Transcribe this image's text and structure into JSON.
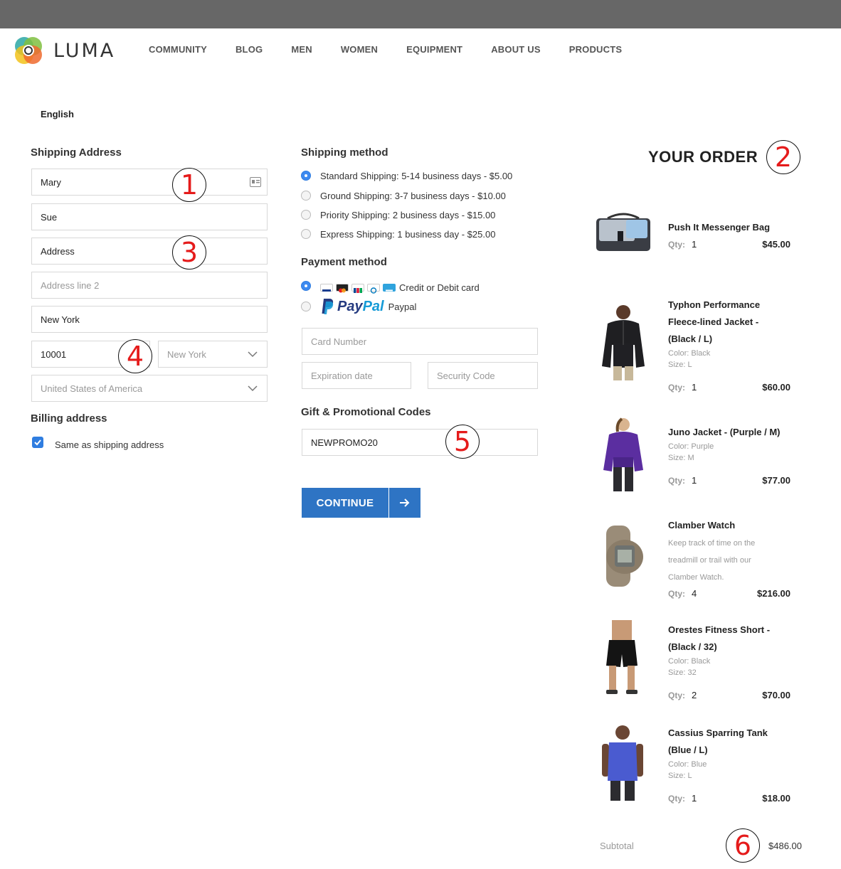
{
  "header": {
    "brand": "LUMA",
    "nav": [
      "COMMUNITY",
      "BLOG",
      "MEN",
      "WOMEN",
      "EQUIPMENT",
      "ABOUT US",
      "PRODUCTS"
    ]
  },
  "language": "English",
  "shipping_address": {
    "title": "Shipping Address",
    "first_name": "Mary",
    "last_name": "Sue",
    "address": "Address",
    "address2_placeholder": "Address line 2",
    "city": "New York",
    "zip": "10001",
    "state_placeholder": "New York",
    "country_placeholder": "United States of America"
  },
  "billing": {
    "title": "Billing address",
    "same_as_shipping_label": "Same as shipping address",
    "same_as_shipping_checked": true
  },
  "shipping_method": {
    "title": "Shipping method",
    "options": [
      "Standard Shipping: 5-14 business days - $5.00",
      "Ground Shipping: 3-7 business days - $10.00",
      "Priority Shipping: 2 business days - $15.00",
      "Express Shipping: 1 business day - $25.00"
    ],
    "selected_index": 0
  },
  "payment_method": {
    "title": "Payment method",
    "card_label": "Credit or Debit card",
    "paypal_logo_pay": "Pay",
    "paypal_logo_pal": "Pal",
    "paypal_label": "Paypal",
    "card_number_placeholder": "Card Number",
    "expiration_placeholder": "Expiration date",
    "security_placeholder": "Security Code"
  },
  "promo": {
    "title": "Gift & Promotional Codes",
    "code": "NEWPROMO20"
  },
  "continue_label": "CONTINUE",
  "order": {
    "title": "YOUR ORDER",
    "qty_label": "Qty:",
    "items": [
      {
        "name": "Push It Messenger Bag",
        "qty": "1",
        "price": "$45.00"
      },
      {
        "name_lines": [
          "Typhon Performance",
          "Fleece-lined Jacket -",
          "(Black / L)"
        ],
        "color": "Color: Black",
        "size": "Size: L",
        "qty": "1",
        "price": "$60.00"
      },
      {
        "name": "Juno Jacket - (Purple / M)",
        "color": "Color: Purple",
        "size": "Size: M",
        "qty": "1",
        "price": "$77.00"
      },
      {
        "name": "Clamber Watch",
        "desc_lines": [
          "Keep track of time on the",
          "treadmill or trail with our",
          "Clamber Watch."
        ],
        "qty": "4",
        "price": "$216.00"
      },
      {
        "name_lines": [
          "Orestes Fitness Short -",
          "(Black / 32)"
        ],
        "color": "Color: Black",
        "size": "Size: 32",
        "qty": "2",
        "price": "$70.00"
      },
      {
        "name_lines": [
          "Cassius Sparring Tank",
          "(Blue / L)"
        ],
        "color": "Color: Blue",
        "size": "Size: L",
        "qty": "1",
        "price": "$18.00"
      }
    ],
    "subtotal_label": "Subtotal",
    "subtotal_value": "$486.00"
  },
  "annotations": [
    "1",
    "2",
    "3",
    "4",
    "5",
    "6"
  ],
  "colors": {
    "accent": "#2e74c4",
    "radio": "#3d8af0",
    "annotation": "#e51b1b",
    "topbar": "#676767"
  }
}
